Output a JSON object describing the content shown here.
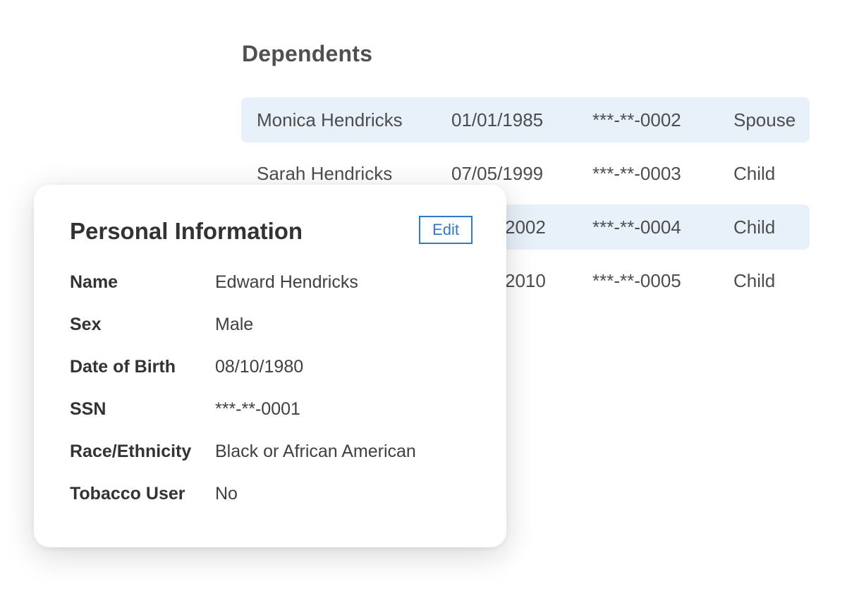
{
  "dependents": {
    "title": "Dependents",
    "rows": [
      {
        "name": "Monica Hendricks",
        "dob": "01/01/1985",
        "ssn": "***-**-0002",
        "relationship": "Spouse"
      },
      {
        "name": "Sarah Hendricks",
        "dob": "07/05/1999",
        "ssn": "***-**-0003",
        "relationship": "Child"
      },
      {
        "name": "",
        "dob": "2002",
        "ssn": "***-**-0004",
        "relationship": "Child"
      },
      {
        "name": "",
        "dob": "2010",
        "ssn": "***-**-0005",
        "relationship": "Child"
      }
    ]
  },
  "personal_info": {
    "title": "Personal Information",
    "edit_label": "Edit",
    "fields": [
      {
        "label": "Name",
        "value": "Edward Hendricks"
      },
      {
        "label": "Sex",
        "value": "Male"
      },
      {
        "label": "Date of Birth",
        "value": "08/10/1980"
      },
      {
        "label": "SSN",
        "value": "***-**-0001"
      },
      {
        "label": "Race/Ethnicity",
        "value": "Black or African American"
      },
      {
        "label": "Tobacco User",
        "value": "No"
      }
    ]
  },
  "colors": {
    "accent": "#2f7bc8",
    "row_highlight": "#e8f0fa"
  }
}
